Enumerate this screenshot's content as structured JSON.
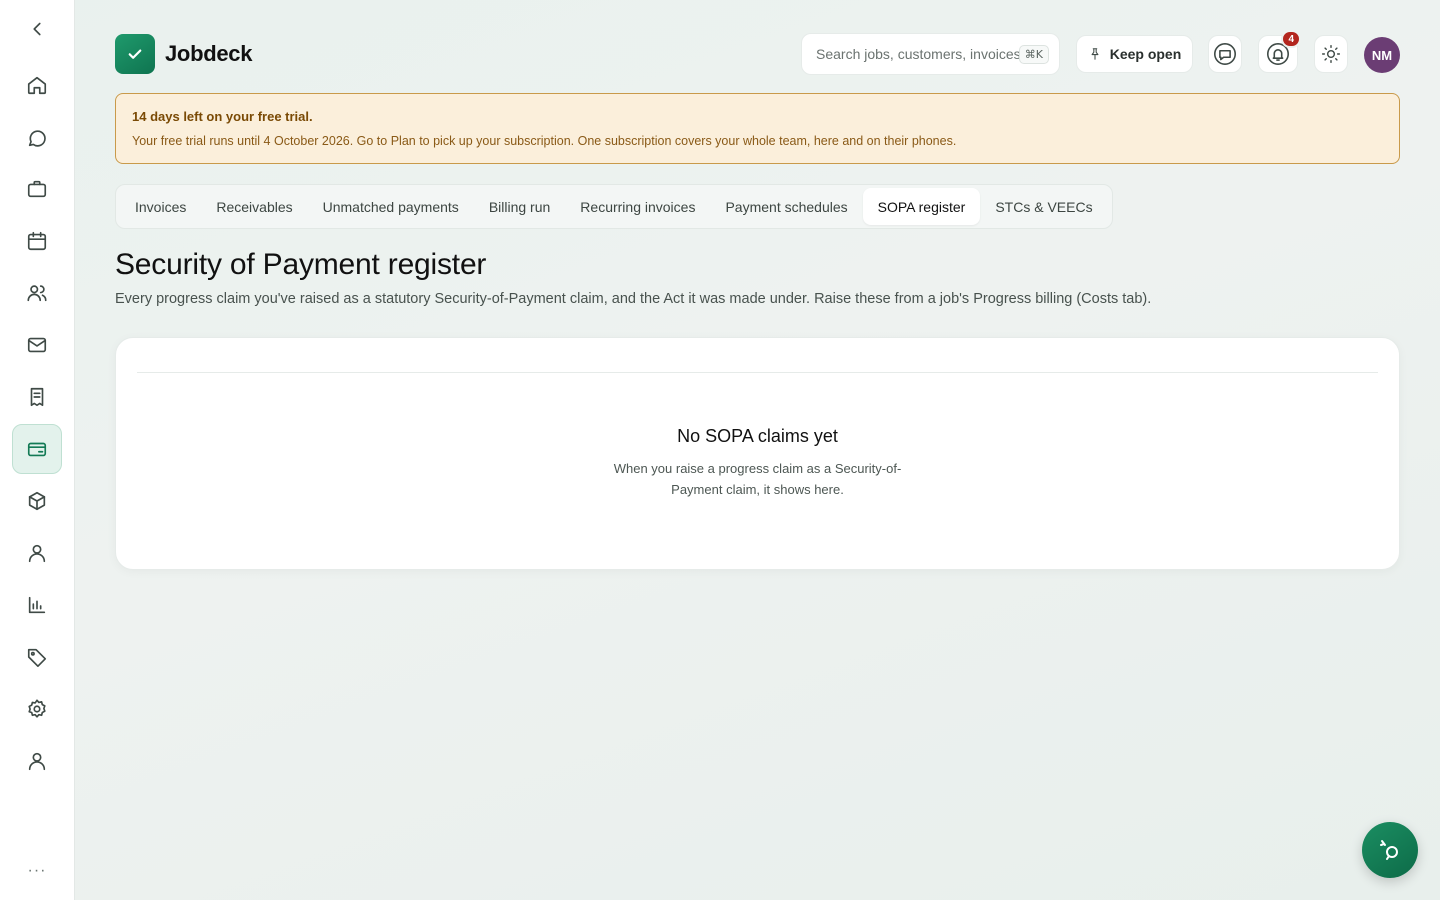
{
  "app": {
    "name": "Jobdeck"
  },
  "sidebar": {
    "items": [
      {
        "icon": "chevron-left-icon"
      },
      {
        "icon": "home-icon"
      },
      {
        "icon": "chat-icon"
      },
      {
        "icon": "briefcase-icon"
      },
      {
        "icon": "calendar-icon"
      },
      {
        "icon": "users-icon"
      },
      {
        "icon": "mail-icon"
      },
      {
        "icon": "receipt-icon"
      },
      {
        "icon": "credit-card-icon",
        "active": true
      },
      {
        "icon": "box-icon"
      },
      {
        "icon": "person-icon"
      },
      {
        "icon": "bar-chart-icon"
      },
      {
        "icon": "tag-icon"
      },
      {
        "icon": "settings-icon"
      },
      {
        "icon": "user-icon"
      }
    ],
    "more_label": "···"
  },
  "header": {
    "search_placeholder": "Search jobs, customers, invoices",
    "search_shortcut": "⌘K",
    "keep_open_label": "Keep open",
    "notifications_count": "4",
    "avatar_initials": "NM"
  },
  "trial_banner": {
    "title": "14 days left on your free trial.",
    "body": "Your free trial runs until 4 October 2026. Go to Plan to pick up your subscription. One subscription covers your whole team, here and on their phones."
  },
  "tabs": [
    {
      "label": "Invoices",
      "active": false
    },
    {
      "label": "Receivables",
      "active": false
    },
    {
      "label": "Unmatched payments",
      "active": false
    },
    {
      "label": "Billing run",
      "active": false
    },
    {
      "label": "Recurring invoices",
      "active": false
    },
    {
      "label": "Payment schedules",
      "active": false
    },
    {
      "label": "SOPA register",
      "active": true
    },
    {
      "label": "STCs & VEECs",
      "active": false
    }
  ],
  "page": {
    "title": "Security of Payment register",
    "subtitle": "Every progress claim you've raised as a statutory Security-of-Payment claim, and the Act it was made under. Raise these from a job's Progress billing (Costs tab)."
  },
  "empty_state": {
    "title": "No SOPA claims yet",
    "body": "When you raise a progress claim as a Security-of-Payment claim, it shows here."
  },
  "colors": {
    "brand": "#137a55",
    "banner_bg": "#fbefdb",
    "banner_border": "#c99a4a",
    "badge": "#b3261e",
    "avatar": "#6b3d74"
  }
}
